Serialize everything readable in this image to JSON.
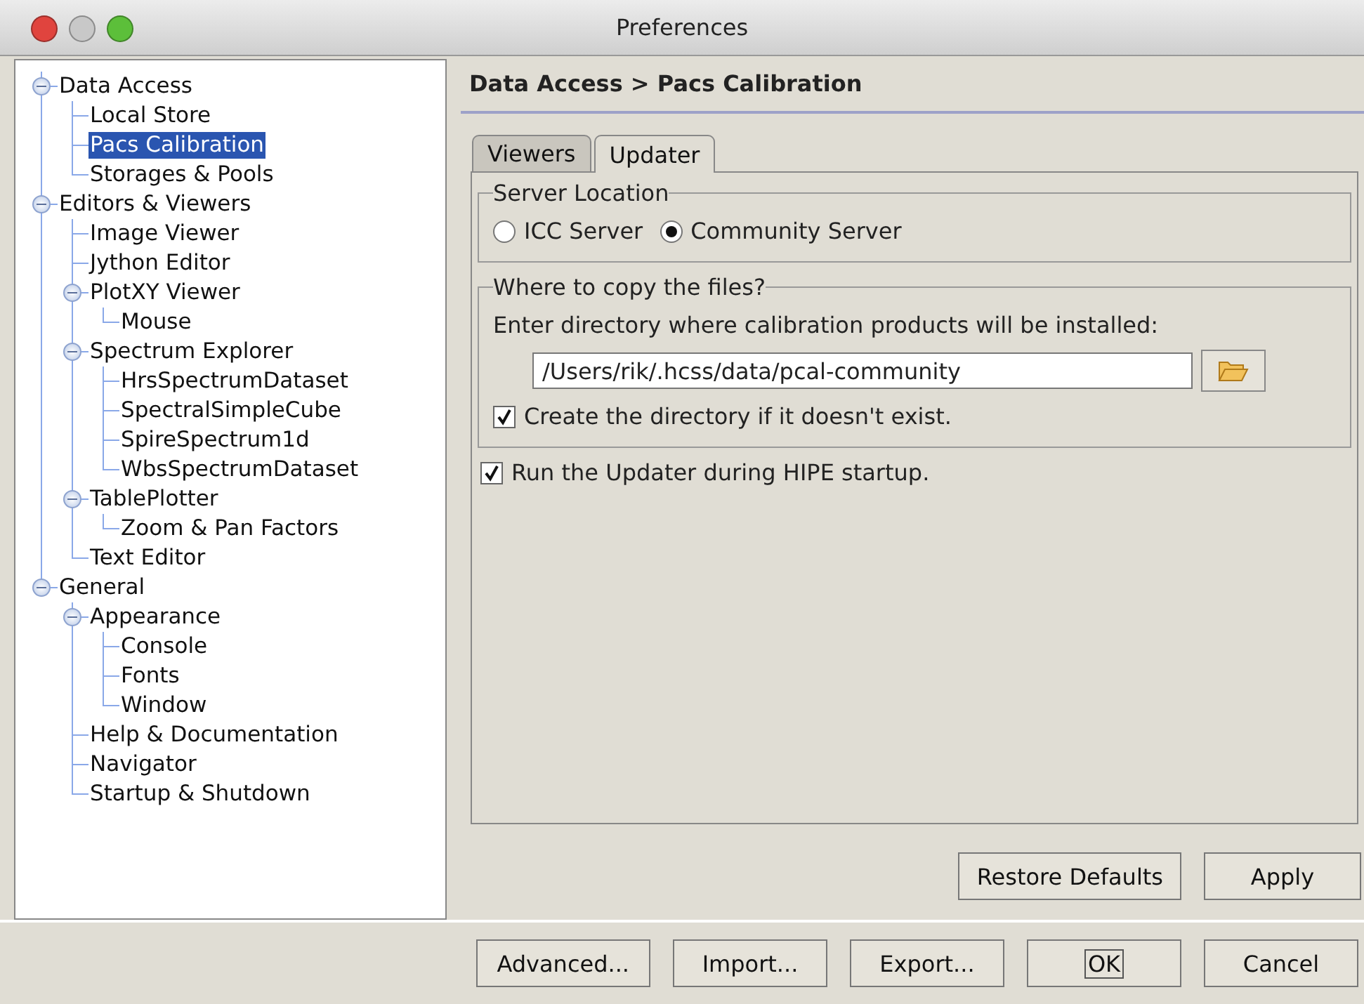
{
  "window": {
    "title": "Preferences"
  },
  "tree": [
    {
      "label": "Data Access",
      "selected": false,
      "expanded": true,
      "children": [
        {
          "label": "Local Store",
          "selected": false
        },
        {
          "label": "Pacs Calibration",
          "selected": true
        },
        {
          "label": "Storages & Pools",
          "selected": false
        }
      ]
    },
    {
      "label": "Editors & Viewers",
      "selected": false,
      "expanded": true,
      "children": [
        {
          "label": "Image Viewer",
          "selected": false
        },
        {
          "label": "Jython Editor",
          "selected": false
        },
        {
          "label": "PlotXY Viewer",
          "selected": false,
          "expanded": true,
          "children": [
            {
              "label": "Mouse",
              "selected": false
            }
          ]
        },
        {
          "label": "Spectrum Explorer",
          "selected": false,
          "expanded": true,
          "children": [
            {
              "label": "HrsSpectrumDataset",
              "selected": false
            },
            {
              "label": "SpectralSimpleCube",
              "selected": false
            },
            {
              "label": "SpireSpectrum1d",
              "selected": false
            },
            {
              "label": "WbsSpectrumDataset",
              "selected": false
            }
          ]
        },
        {
          "label": "TablePlotter",
          "selected": false,
          "expanded": true,
          "children": [
            {
              "label": "Zoom & Pan Factors",
              "selected": false
            }
          ]
        },
        {
          "label": "Text Editor",
          "selected": false
        }
      ]
    },
    {
      "label": "General",
      "selected": false,
      "expanded": true,
      "children": [
        {
          "label": "Appearance",
          "selected": false,
          "expanded": true,
          "children": [
            {
              "label": "Console",
              "selected": false
            },
            {
              "label": "Fonts",
              "selected": false
            },
            {
              "label": "Window",
              "selected": false
            }
          ]
        },
        {
          "label": "Help & Documentation",
          "selected": false
        },
        {
          "label": "Navigator",
          "selected": false
        },
        {
          "label": "Startup & Shutdown",
          "selected": false
        }
      ]
    }
  ],
  "breadcrumb": "Data Access > Pacs Calibration",
  "tabs": [
    {
      "label": "Viewers",
      "selected": false
    },
    {
      "label": "Updater",
      "selected": true
    }
  ],
  "server_location": {
    "title": "Server Location",
    "options": [
      {
        "label": "ICC Server",
        "selected": false
      },
      {
        "label": "Community Server",
        "selected": true
      }
    ]
  },
  "copy_files": {
    "title": "Where to copy the files?",
    "prompt": "Enter directory where calibration products will be installed:",
    "path": "/Users/rik/.hcss/data/pcal-community",
    "create_directory": {
      "label": "Create the directory if it doesn't exist.",
      "checked": true
    }
  },
  "run_updater": {
    "label": "Run the Updater during HIPE startup.",
    "checked": true
  },
  "panel_buttons": [
    "Restore Defaults",
    "Apply"
  ],
  "dialog_buttons": [
    {
      "label": "Advanced...",
      "focused": false
    },
    {
      "label": "Import...",
      "focused": false
    },
    {
      "label": "Export...",
      "focused": false
    },
    {
      "label": "OK",
      "focused": true
    },
    {
      "label": "Cancel",
      "focused": false
    }
  ]
}
